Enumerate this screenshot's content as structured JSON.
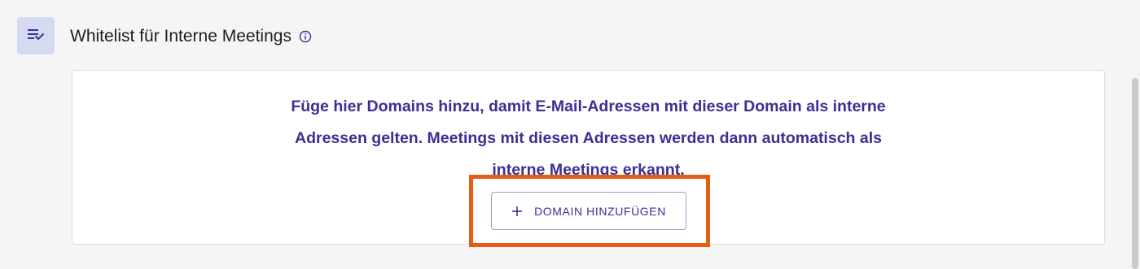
{
  "section": {
    "title": "Whitelist für Interne Meetings",
    "icon": "playlist-check-icon",
    "info_icon": "info-circle-icon"
  },
  "card": {
    "message_lines": [
      "Füge hier Domains hinzu, damit E-Mail-Adressen mit dieser Domain als interne",
      "Adressen gelten. Meetings mit diesen Adressen werden dann automatisch als",
      "interne Meetings erkannt."
    ],
    "add_button": {
      "label": "DOMAIN HINZUFÜGEN",
      "icon": "plus-icon"
    }
  },
  "colors": {
    "accent": "#3d2f93",
    "icon_background": "#d6d9f2",
    "highlight": "#e35d15",
    "page_background": "#f5f5f5"
  }
}
